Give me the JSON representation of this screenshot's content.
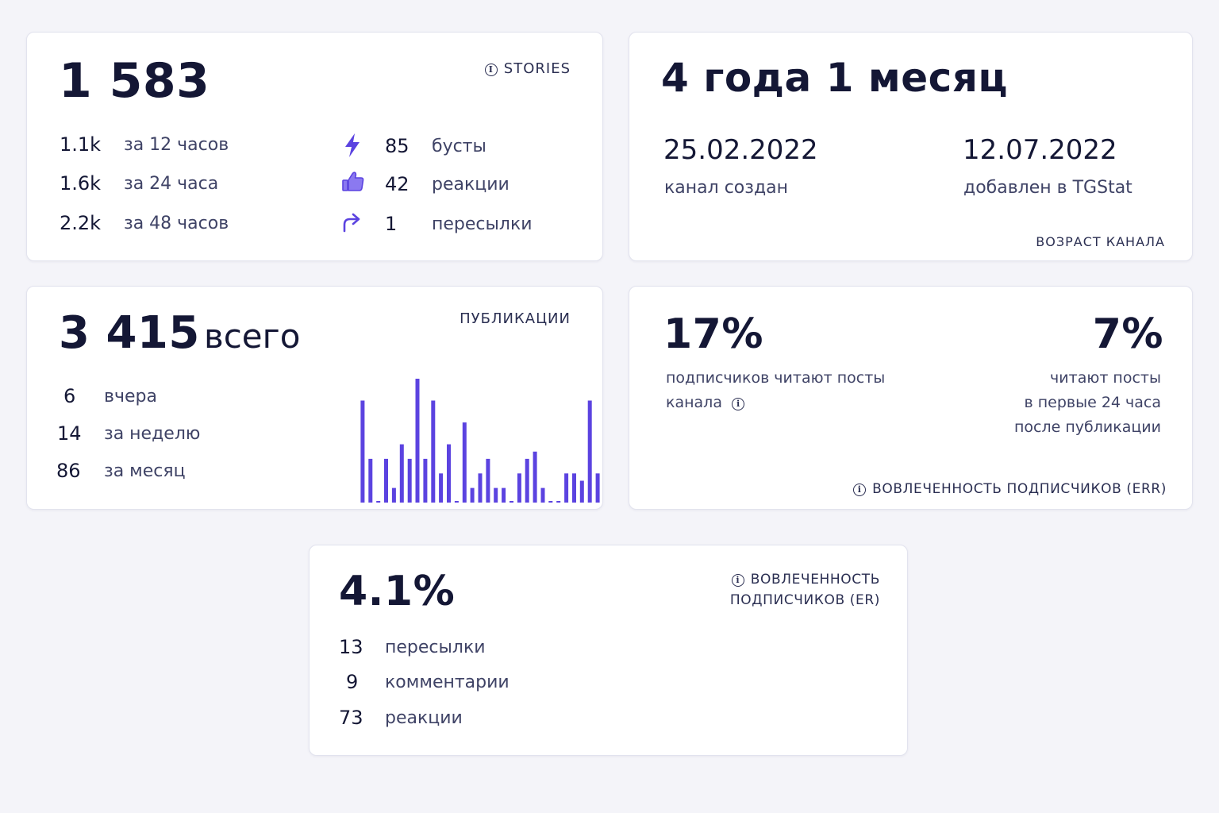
{
  "stories": {
    "total": "1 583",
    "tag": "STORIES",
    "periods": [
      {
        "value": "1.1k",
        "label": "за 12 часов"
      },
      {
        "value": "1.6k",
        "label": "за 24 часа"
      },
      {
        "value": "2.2k",
        "label": "за 48 часов"
      }
    ],
    "stats": [
      {
        "icon": "lightning-icon",
        "value": "85",
        "label": "бусты"
      },
      {
        "icon": "thumbs-up-icon",
        "value": "42",
        "label": "реакции"
      },
      {
        "icon": "forward-arrow-icon",
        "value": "1",
        "label": "пересылки"
      }
    ]
  },
  "age": {
    "title": "4 года 1 месяц",
    "created_date": "25.02.2022",
    "created_label": "канал создан",
    "added_date": "12.07.2022",
    "added_label": "добавлен в TGStat",
    "tag": "ВОЗРАСТ КАНАЛА"
  },
  "publications": {
    "total_number": "3 415",
    "total_suffix": "всего",
    "tag": "ПУБЛИКАЦИИ",
    "periods": [
      {
        "value": "6",
        "label": "вчера"
      },
      {
        "value": "14",
        "label": "за неделю"
      },
      {
        "value": "86",
        "label": "за месяц"
      }
    ]
  },
  "err": {
    "left_value": "17%",
    "left_line1": "подписчиков читают посты",
    "left_line2": "канала",
    "right_value": "7%",
    "right_line1": "читают посты",
    "right_line2": "в первые 24 часа",
    "right_line3": "после публикации",
    "tag": "ВОВЛЕЧЕННОСТЬ ПОДПИСЧИКОВ (ERR)"
  },
  "er": {
    "value": "4.1%",
    "tag_line1": "ВОВЛЕЧЕННОСТЬ",
    "tag_line2": "ПОДПИСЧИКОВ (ER)",
    "stats": [
      {
        "value": "13",
        "label": "пересылки"
      },
      {
        "value": "9",
        "label": "комментарии"
      },
      {
        "value": "73",
        "label": "реакции"
      }
    ]
  },
  "colors": {
    "accent": "#5b43e0",
    "text_dark": "#141735",
    "text_muted": "#3f4366"
  },
  "chart_data": {
    "type": "bar",
    "values": [
      14,
      6,
      0,
      6,
      2,
      8,
      6,
      17,
      6,
      14,
      4,
      8,
      0,
      11,
      2,
      4,
      6,
      2,
      2,
      0,
      4,
      6,
      7,
      2,
      0,
      0,
      4,
      4,
      3,
      14,
      4
    ],
    "ylim": [
      0,
      17
    ]
  }
}
